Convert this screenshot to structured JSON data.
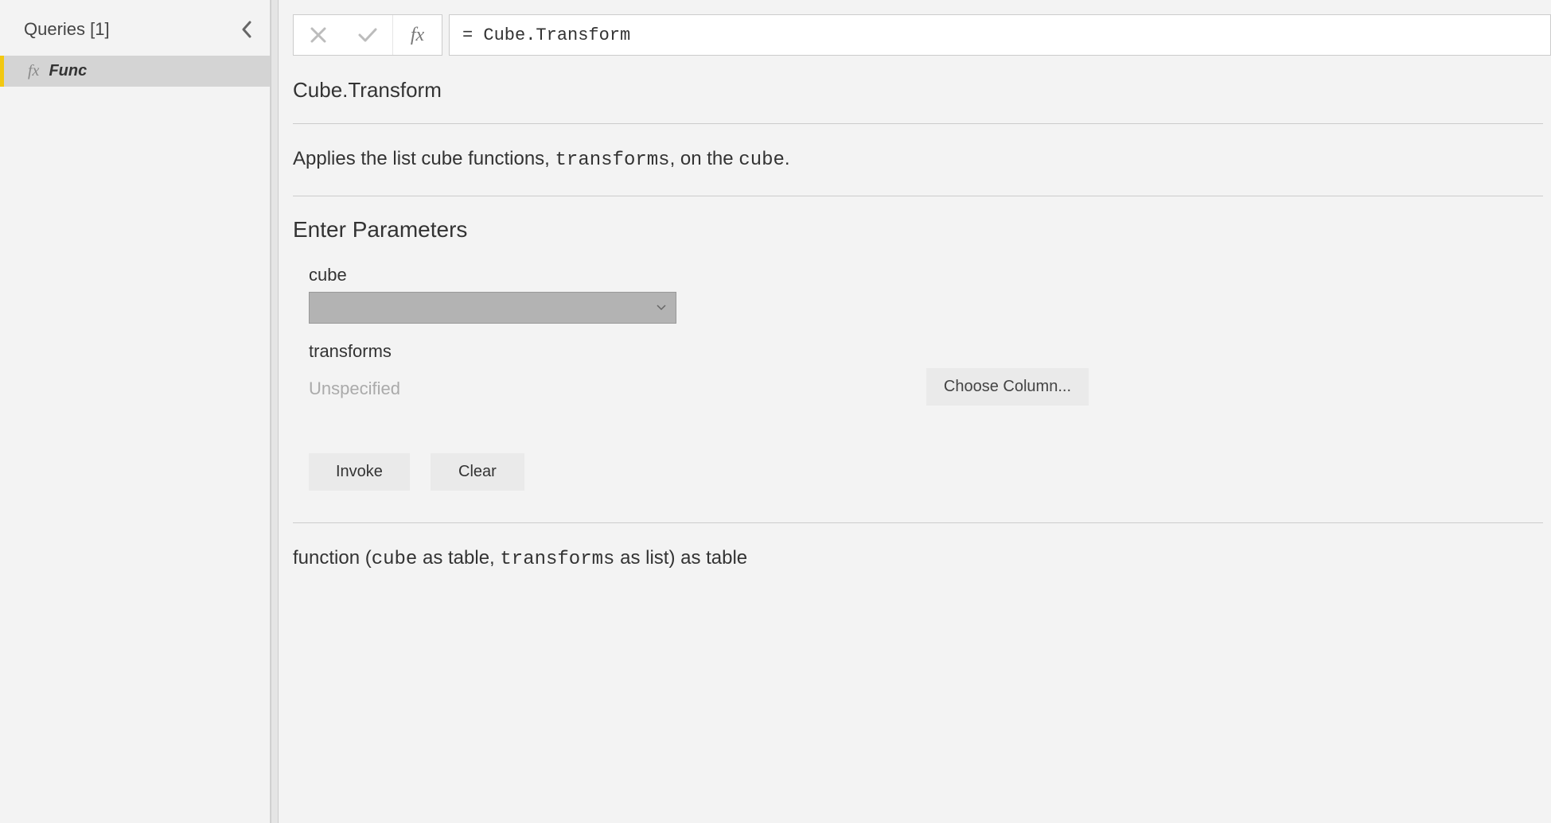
{
  "sidebar": {
    "title": "Queries [1]",
    "items": [
      {
        "icon": "fx",
        "label": "Func"
      }
    ]
  },
  "formula_bar": {
    "expression": "= Cube.Transform"
  },
  "function": {
    "name": "Cube.Transform",
    "description_pre": "Applies the list cube functions, ",
    "description_code1": "transforms",
    "description_mid": ", on the ",
    "description_code2": "cube",
    "description_post": "."
  },
  "parameters": {
    "heading": "Enter Parameters",
    "param1_label": "cube",
    "param2_label": "transforms",
    "unspecified": "Unspecified",
    "choose_column": "Choose Column..."
  },
  "actions": {
    "invoke": "Invoke",
    "clear": "Clear"
  },
  "signature": {
    "s1": "function (",
    "s2": "cube",
    "s3": " as table, ",
    "s4": "transforms",
    "s5": " as list) as table"
  }
}
